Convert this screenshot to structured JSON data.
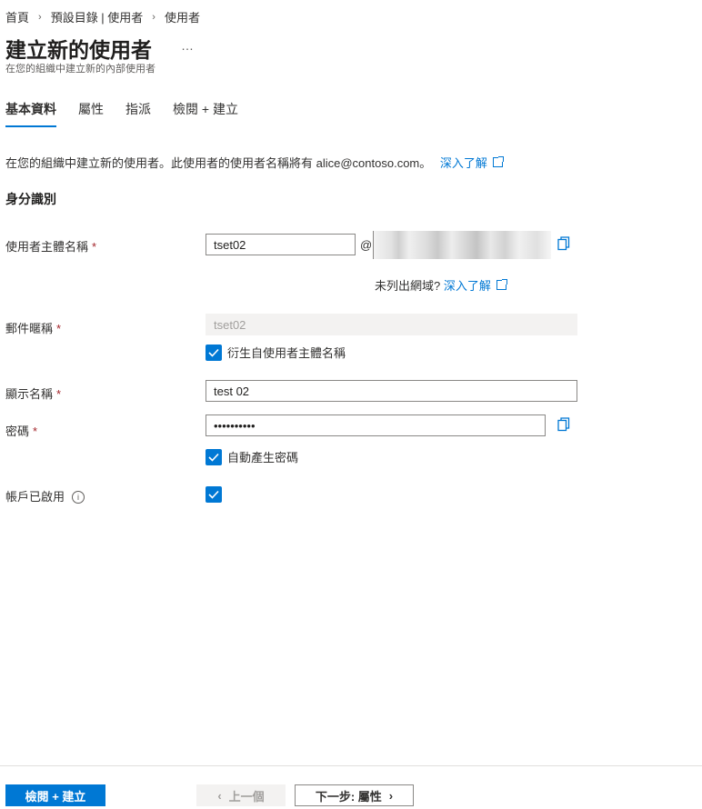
{
  "breadcrumb": [
    "首頁",
    "預設目錄 | 使用者",
    "使用者"
  ],
  "page": {
    "title": "建立新的使用者",
    "more": "…",
    "subtitle": "在您的組織中建立新的內部使用者"
  },
  "tabs": [
    "基本資料",
    "屬性",
    "指派",
    "檢閱 + 建立"
  ],
  "intro": {
    "text": "在您的組織中建立新的使用者。此使用者的使用者名稱將有 alice@contoso.com。",
    "link": "深入了解"
  },
  "section_title": "身分識別",
  "fields": {
    "upn": {
      "label": "使用者主體名稱",
      "required": "*",
      "value": "tset02",
      "at": "@"
    },
    "domain_note": {
      "text": "未列出網域?",
      "link": "深入了解"
    },
    "mail_nickname": {
      "label": "郵件暱稱",
      "required": "*",
      "value": "tset02"
    },
    "derive_checkbox": {
      "label": "衍生自使用者主體名稱",
      "checked": true
    },
    "display_name": {
      "label": "顯示名稱",
      "required": "*",
      "value": "test 02"
    },
    "password": {
      "label": "密碼",
      "required": "*",
      "value": "••••••••••"
    },
    "autogen_checkbox": {
      "label": "自動產生密碼",
      "checked": true
    },
    "account_enabled": {
      "label": "帳戶已啟用",
      "info": "i",
      "checked": true
    }
  },
  "footer": {
    "primary": "檢閱 + 建立",
    "prev": "上一個",
    "next": "下一步: 屬性"
  },
  "colors": {
    "accent": "#0078d4",
    "required": "#a4262c"
  },
  "icons": [
    "chevron-right-icon",
    "external-link-icon",
    "copy-icon",
    "checkmark-icon",
    "info-icon",
    "chevron-left-icon"
  ]
}
